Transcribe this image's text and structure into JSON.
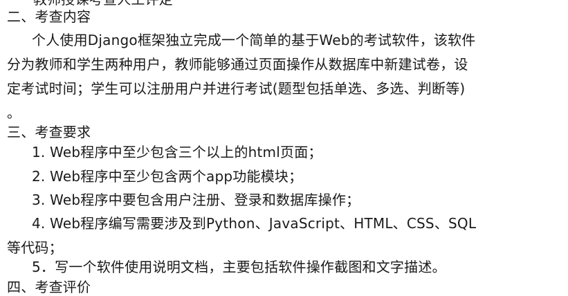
{
  "document": {
    "cut_top_line": "教师授课考查人工评定",
    "section2_heading": "二、考查内容",
    "section2_para_line1": "个人使用Django框架独立完成一个简单的基于Web的考试软件，该软件",
    "section2_para_line2": "分为教师和学生两种用户，教师能够通过页面操作从数据库中新建试卷，设",
    "section2_para_line3": "定考试时间；学生可以注册用户并进行考试(题型包括单选、多选、判断等)",
    "section2_para_line4": "。",
    "section3_heading": "三、考查要求",
    "req1": "1. Web程序中至少包含三个以上的html页面；",
    "req2": "2. Web程序中至少包含两个app功能模块；",
    "req3": "3. Web程序中要包含用户注册、登录和数据库操作；",
    "req4_line1": "4.   Web程序编写需要涉及到Python、JavaScript、HTML、CSS、SQL",
    "req4_line2": "等代码；",
    "req5": "5．写一个软件使用说明文档，主要包括软件操作截图和文字描述。",
    "section4_heading_cut": "四、考查评价"
  }
}
